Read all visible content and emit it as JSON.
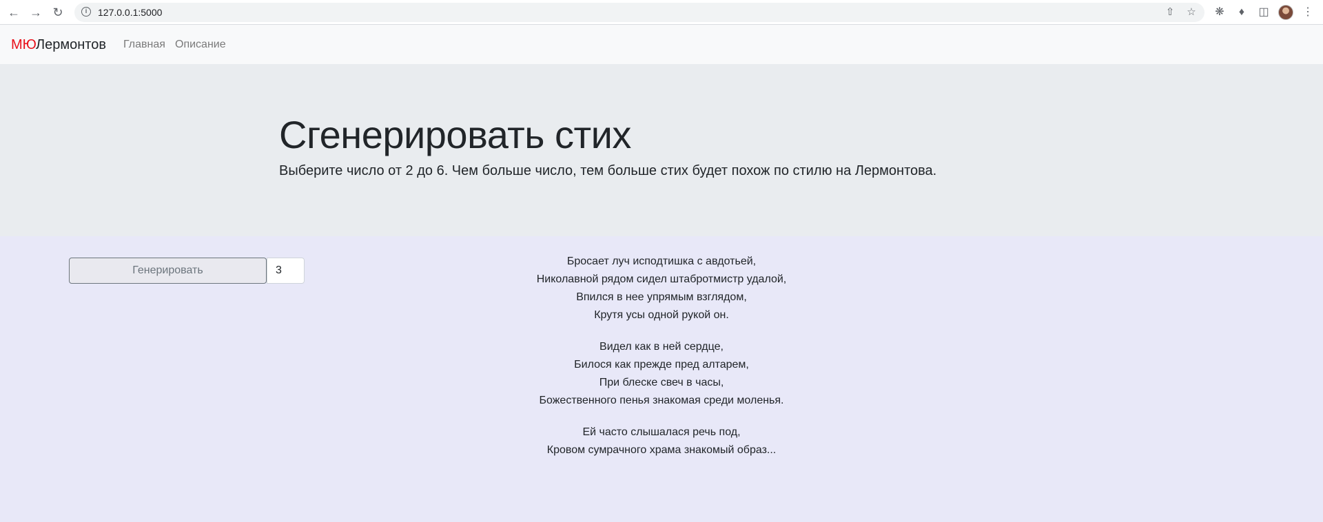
{
  "browser": {
    "url": "127.0.0.1:5000",
    "icons": [
      "back-icon",
      "forward-icon",
      "reload-icon",
      "site-info-icon",
      "share-icon",
      "bookmark-star-icon",
      "extension-icon",
      "puzzle-icon",
      "side-panel-icon",
      "avatar",
      "menu-dots-icon"
    ]
  },
  "navbar": {
    "brand_accent": "МЮ",
    "brand_rest": "Лермонтов",
    "links": [
      "Главная",
      "Описание"
    ],
    "accent_color": "#e8101a"
  },
  "hero": {
    "title": "Сгенерировать стих",
    "lead": "Выберите число от 2 до 6. Чем больше число, тем больше стих будет похож по стилю на Лермонтова."
  },
  "form": {
    "button_label": "Генерировать",
    "number_value": "3"
  },
  "poem": {
    "stanzas": [
      [
        "Бросает луч исподтишка с авдотьей,",
        "Николавной рядом сидел штабротмистр удалой,",
        "Впился в нее упрямым взглядом,",
        "Крутя усы одной рукой он."
      ],
      [
        "Видел как в ней сердце,",
        "Билося как прежде пред алтарем,",
        "При блеске свеч в часы,",
        "Божественного пенья знакомая среди моленья."
      ],
      [
        "Ей часто слышалася речь под,",
        "Кровом сумрачного храма знакомый образ..."
      ]
    ]
  }
}
